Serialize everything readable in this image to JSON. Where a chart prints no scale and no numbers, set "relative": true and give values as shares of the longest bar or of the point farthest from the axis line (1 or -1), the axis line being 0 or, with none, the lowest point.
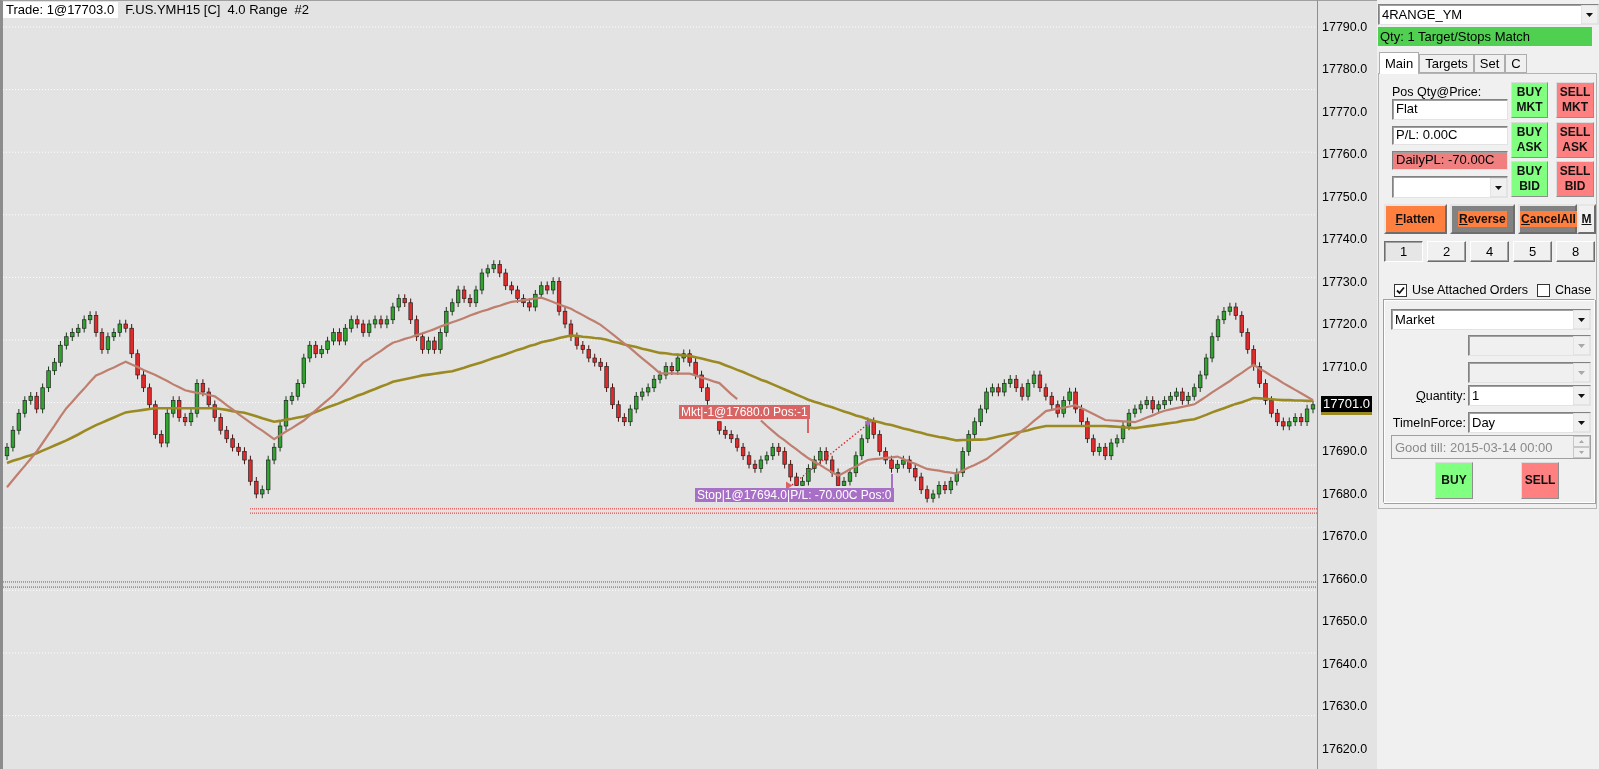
{
  "chart": {
    "header": {
      "trade": "Trade: 1@17703.0",
      "symbol": "F.US.YMH15 [C]",
      "bar_type": "4.0 Range",
      "chart_number": "#2"
    },
    "order_labels": [
      {
        "kind": "market",
        "text": "Mkt|-1@17680.0 Pos:-1",
        "color": "#d86464"
      },
      {
        "kind": "stop",
        "text": "Stop|1@17694.0|P/L: -70.00C Pos:0",
        "color": "#a86fc6"
      }
    ],
    "last_price": "17701.0",
    "chart_data": {
      "type": "candlestick",
      "ylim": [
        17615.29,
        17796.24
      ],
      "yticks": [
        {
          "value": 17790,
          "label": "17790.0"
        },
        {
          "value": 17780,
          "label": "17780.0"
        },
        {
          "value": 17770,
          "label": "17770.0"
        },
        {
          "value": 17760,
          "label": "17760.0"
        },
        {
          "value": 17750,
          "label": "17750.0"
        },
        {
          "value": 17740,
          "label": "17740.0"
        },
        {
          "value": 17730,
          "label": "17730.0"
        },
        {
          "value": 17720,
          "label": "17720.0"
        },
        {
          "value": 17710,
          "label": "17710.0"
        },
        {
          "value": 17690,
          "label": "17690.0"
        },
        {
          "value": 17680,
          "label": "17680.0"
        },
        {
          "value": 17670,
          "label": "17670.0"
        },
        {
          "value": 17660,
          "label": "17660.0"
        },
        {
          "value": 17650,
          "label": "17650.0"
        },
        {
          "value": 17640,
          "label": "17640.0"
        },
        {
          "value": 17630,
          "label": "17630.0"
        },
        {
          "value": 17620,
          "label": "17620.0"
        }
      ],
      "categories": [
        null,
        null,
        null,
        null,
        null,
        null,
        null,
        null,
        null,
        null,
        null,
        null,
        null,
        null,
        null,
        null,
        null,
        null,
        null,
        null,
        null,
        null,
        null,
        null,
        null,
        null,
        null,
        null,
        null,
        null,
        null,
        null,
        null,
        null,
        null,
        null,
        null,
        null,
        null,
        null,
        null,
        null,
        null,
        null,
        null,
        null,
        null,
        null,
        null,
        null,
        null,
        null,
        null,
        null,
        null,
        null,
        null,
        null,
        null,
        null,
        null,
        null,
        null,
        null,
        null,
        null,
        null,
        null,
        null,
        null,
        null,
        null,
        null,
        null,
        null,
        null,
        null,
        null,
        null,
        null,
        null,
        null,
        null,
        null,
        null,
        null,
        null,
        null,
        null,
        null,
        null,
        null,
        null,
        null,
        null,
        null,
        null,
        null,
        null,
        null,
        null,
        null,
        null,
        null,
        null,
        null,
        null,
        null,
        null,
        null,
        null,
        null,
        null,
        null,
        null,
        null,
        null,
        null,
        null,
        null,
        null,
        null,
        null,
        null,
        null,
        null,
        null,
        null,
        null,
        null,
        null,
        null,
        null,
        null,
        null,
        null,
        null,
        null,
        null,
        null,
        null,
        null,
        null,
        null,
        null,
        null,
        null,
        null,
        null,
        null,
        null,
        null,
        null,
        null,
        null,
        null,
        null,
        null,
        null,
        null,
        null,
        null,
        null,
        null,
        null,
        null,
        null,
        null,
        null,
        null,
        null,
        null,
        null,
        null,
        null,
        null,
        null,
        null,
        null,
        null,
        null,
        null,
        null,
        null,
        null,
        null,
        null,
        null,
        null,
        null,
        null,
        null,
        null,
        null,
        null,
        null,
        null,
        null,
        null,
        null,
        null,
        null,
        null,
        null,
        null,
        null,
        null,
        null,
        null,
        null,
        null,
        null,
        null,
        null,
        null,
        null,
        null,
        null,
        null,
        null,
        null
      ],
      "ohlc": [
        [
          17689,
          17692,
          17688,
          17691
        ],
        [
          17691,
          17696,
          17690,
          17695
        ],
        [
          17695,
          17700,
          17694,
          17699
        ],
        [
          17699,
          17703,
          17698,
          17702
        ],
        [
          17702,
          17704,
          17701,
          17703
        ],
        [
          17703,
          17704,
          17699,
          17700
        ],
        [
          17700,
          17706,
          17699,
          17705
        ],
        [
          17705,
          17710,
          17704,
          17709
        ],
        [
          17709,
          17712,
          17708,
          17711
        ],
        [
          17711,
          17716,
          17710,
          17715
        ],
        [
          17715,
          17718,
          17714,
          17717
        ],
        [
          17717,
          17719,
          17716,
          17718
        ],
        [
          17718,
          17720,
          17717,
          17719
        ],
        [
          17719,
          17722,
          17718,
          17721
        ],
        [
          17721,
          17723,
          17720,
          17722
        ],
        [
          17722,
          17723,
          17717,
          17718
        ],
        [
          17718,
          17719,
          17713,
          17714
        ],
        [
          17714,
          17718,
          17713,
          17717
        ],
        [
          17717,
          17719,
          17716,
          17718
        ],
        [
          17718,
          17721,
          17717,
          17720
        ],
        [
          17720,
          17721,
          17718,
          17719
        ],
        [
          17719,
          17720,
          17712,
          17713
        ],
        [
          17713,
          17714,
          17707,
          17708
        ],
        [
          17708,
          17709,
          17704,
          17705
        ],
        [
          17705,
          17706,
          17700,
          17701
        ],
        [
          17701,
          17702,
          17693,
          17694
        ],
        [
          17694,
          17695,
          17691,
          17692
        ],
        [
          17692,
          17700,
          17691,
          17699
        ],
        [
          17699,
          17703,
          17698,
          17702
        ],
        [
          17702,
          17703,
          17697,
          17698
        ],
        [
          17698,
          17699,
          17696,
          17697
        ],
        [
          17697,
          17700,
          17696,
          17699
        ],
        [
          17699,
          17707,
          17698,
          17706
        ],
        [
          17706,
          17707,
          17703,
          17704
        ],
        [
          17704,
          17705,
          17700,
          17701
        ],
        [
          17701,
          17702,
          17697,
          17698
        ],
        [
          17698,
          17699,
          17694,
          17695
        ],
        [
          17695,
          17696,
          17692,
          17693
        ],
        [
          17693,
          17694,
          17690,
          17691
        ],
        [
          17691,
          17692,
          17689,
          17690
        ],
        [
          17690,
          17691,
          17687,
          17688
        ],
        [
          17688,
          17689,
          17682,
          17683
        ],
        [
          17683,
          17684,
          17679,
          17680
        ],
        [
          17680,
          17682,
          17679,
          17681
        ],
        [
          17681,
          17689,
          17680,
          17688
        ],
        [
          17688,
          17692,
          17687,
          17691
        ],
        [
          17691,
          17697,
          17690,
          17696
        ],
        [
          17696,
          17703,
          17695,
          17702
        ],
        [
          17702,
          17704,
          17701,
          17703
        ],
        [
          17703,
          17707,
          17702,
          17706
        ],
        [
          17706,
          17713,
          17705,
          17712
        ],
        [
          17712,
          17716,
          17711,
          17715
        ],
        [
          17715,
          17716,
          17712,
          17713
        ],
        [
          17713,
          17715,
          17712,
          17714
        ],
        [
          17714,
          17717,
          17713,
          17716
        ],
        [
          17716,
          17719,
          17715,
          17718
        ],
        [
          17718,
          17719,
          17715,
          17716
        ],
        [
          17716,
          17720,
          17715,
          17719
        ],
        [
          17719,
          17722,
          17718,
          17721
        ],
        [
          17721,
          17722,
          17719,
          17720
        ],
        [
          17720,
          17721,
          17717,
          17718
        ],
        [
          17718,
          17721,
          17717,
          17720
        ],
        [
          17720,
          17722,
          17719,
          17721
        ],
        [
          17721,
          17722,
          17719,
          17720
        ],
        [
          17720,
          17722,
          17719,
          17721
        ],
        [
          17721,
          17725,
          17720,
          17724
        ],
        [
          17724,
          17727,
          17723,
          17726
        ],
        [
          17726,
          17727,
          17724,
          17725
        ],
        [
          17725,
          17726,
          17720,
          17721
        ],
        [
          17721,
          17722,
          17716,
          17717
        ],
        [
          17717,
          17718,
          17713,
          17714
        ],
        [
          17714,
          17717,
          17713,
          17716
        ],
        [
          17716,
          17717,
          17713,
          17714
        ],
        [
          17714,
          17719,
          17713,
          17718
        ],
        [
          17718,
          17724,
          17717,
          17723
        ],
        [
          17723,
          17726,
          17722,
          17725
        ],
        [
          17725,
          17729,
          17724,
          17728
        ],
        [
          17728,
          17729,
          17725,
          17726
        ],
        [
          17726,
          17727,
          17724,
          17725
        ],
        [
          17725,
          17729,
          17724,
          17728
        ],
        [
          17728,
          17733,
          17727,
          17732
        ],
        [
          17732,
          17734,
          17731,
          17733
        ],
        [
          17733,
          17735,
          17732,
          17734
        ],
        [
          17734,
          17735,
          17731,
          17732
        ],
        [
          17732,
          17733,
          17728,
          17729
        ],
        [
          17729,
          17730,
          17727,
          17728
        ],
        [
          17728,
          17729,
          17725,
          17726
        ],
        [
          17726,
          17727,
          17724,
          17725
        ],
        [
          17725,
          17726,
          17723,
          17724
        ],
        [
          17724,
          17728,
          17723,
          17727
        ],
        [
          17727,
          17730,
          17726,
          17729
        ],
        [
          17729,
          17730,
          17727,
          17728
        ],
        [
          17728,
          17731,
          17727,
          17730
        ],
        [
          17730,
          17731,
          17722,
          17723
        ],
        [
          17723,
          17724,
          17719,
          17720
        ],
        [
          17720,
          17721,
          17716,
          17717
        ],
        [
          17717,
          17718,
          17714,
          17715
        ],
        [
          17715,
          17716,
          17713,
          17714
        ],
        [
          17714,
          17715,
          17711,
          17712
        ],
        [
          17712,
          17713,
          17710,
          17711
        ],
        [
          17711,
          17712,
          17709,
          17710
        ],
        [
          17710,
          17711,
          17704,
          17705
        ],
        [
          17705,
          17706,
          17700,
          17701
        ],
        [
          17701,
          17702,
          17697,
          17698
        ],
        [
          17698,
          17699,
          17696,
          17697
        ],
        [
          17697,
          17701,
          17696,
          17700
        ],
        [
          17700,
          17704,
          17699,
          17703
        ],
        [
          17703,
          17705,
          17702,
          17704
        ],
        [
          17704,
          17706,
          17703,
          17705
        ],
        [
          17705,
          17708,
          17704,
          17707
        ],
        [
          17707,
          17709,
          17706,
          17708
        ],
        [
          17708,
          17711,
          17707,
          17710
        ],
        [
          17710,
          17711,
          17708,
          17709
        ],
        [
          17709,
          17713,
          17708,
          17712
        ],
        [
          17712,
          17714,
          17711,
          17713
        ],
        [
          17713,
          17714,
          17710,
          17711
        ],
        [
          17711,
          17712,
          17707,
          17708
        ],
        [
          17708,
          17709,
          17704,
          17705
        ],
        [
          17705,
          17706,
          17701,
          17702
        ],
        null,
        [
          17697,
          17697,
          17694,
          17695
        ],
        [
          17695,
          17696,
          17693,
          17694
        ],
        [
          17694,
          17695,
          17692,
          17693
        ],
        [
          17693,
          17694,
          17690,
          17691
        ],
        [
          17691,
          17692,
          17688,
          17689
        ],
        [
          17689,
          17690,
          17686,
          17687
        ],
        [
          17687,
          17688,
          17685,
          17686
        ],
        [
          17686,
          17689,
          17685,
          17688
        ],
        [
          17688,
          17690,
          17687,
          17689
        ],
        [
          17689,
          17692,
          17688,
          17691
        ],
        [
          17691,
          17692,
          17689,
          17690
        ],
        [
          17690,
          17691,
          17686,
          17687
        ],
        [
          17687,
          17688,
          17683,
          17684
        ],
        [
          17684,
          17685,
          17682,
          17682
        ],
        [
          17682,
          17684,
          17682,
          17683
        ],
        [
          17683,
          17687,
          17682,
          17686
        ],
        [
          17686,
          17689,
          17685,
          17688
        ],
        [
          17688,
          17691,
          17687,
          17690
        ],
        [
          17690,
          17691,
          17687,
          17688
        ],
        [
          17688,
          17689,
          17684,
          17685
        ],
        [
          17685,
          17686,
          17682,
          17682
        ],
        [
          17682,
          17684,
          17682,
          17683
        ],
        [
          17683,
          17686,
          17682,
          17685
        ],
        [
          17685,
          17690,
          17684,
          17689
        ],
        [
          17689,
          17694,
          17688,
          17693
        ],
        [
          17693,
          17698,
          17692,
          17697
        ],
        [
          17697,
          17698,
          17693,
          17694
        ],
        [
          17694,
          17695,
          17689,
          17690
        ],
        [
          17690,
          17691,
          17687,
          17688
        ],
        [
          17688,
          17689,
          17685,
          17686
        ],
        [
          17686,
          17688,
          17685,
          17687
        ],
        [
          17687,
          17689,
          17686,
          17688
        ],
        [
          17688,
          17689,
          17685,
          17686
        ],
        [
          17686,
          17687,
          17683,
          17684
        ],
        [
          17684,
          17685,
          17680,
          17681
        ],
        [
          17681,
          17682,
          17678,
          17679
        ],
        [
          17679,
          17681,
          17678,
          17680
        ],
        [
          17680,
          17683,
          17679,
          17682
        ],
        [
          17682,
          17683,
          17680,
          17681
        ],
        [
          17681,
          17684,
          17680,
          17683
        ],
        [
          17683,
          17686,
          17682,
          17685
        ],
        [
          17685,
          17691,
          17684,
          17690
        ],
        [
          17690,
          17695,
          17689,
          17694
        ],
        [
          17694,
          17698,
          17693,
          17697
        ],
        [
          17697,
          17701,
          17696,
          17700
        ],
        [
          17700,
          17705,
          17699,
          17704
        ],
        [
          17704,
          17706,
          17703,
          17705
        ],
        [
          17705,
          17706,
          17703,
          17704
        ],
        [
          17704,
          17707,
          17703,
          17706
        ],
        [
          17706,
          17708,
          17705,
          17707
        ],
        [
          17707,
          17708,
          17704,
          17705
        ],
        [
          17705,
          17706,
          17702,
          17703
        ],
        [
          17703,
          17707,
          17702,
          17706
        ],
        [
          17706,
          17709,
          17705,
          17708
        ],
        [
          17708,
          17709,
          17704,
          17705
        ],
        [
          17705,
          17706,
          17702,
          17703
        ],
        [
          17703,
          17704,
          17700,
          17701
        ],
        [
          17701,
          17702,
          17698,
          17699
        ],
        [
          17699,
          17703,
          17698,
          17702
        ],
        [
          17702,
          17705,
          17701,
          17704
        ],
        [
          17704,
          17705,
          17699,
          17700
        ],
        [
          17700,
          17701,
          17696,
          17697
        ],
        [
          17697,
          17698,
          17692,
          17693
        ],
        [
          17693,
          17694,
          17689,
          17690
        ],
        [
          17690,
          17692,
          17689,
          17691
        ],
        [
          17691,
          17692,
          17688,
          17689
        ],
        [
          17689,
          17693,
          17688,
          17692
        ],
        [
          17692,
          17694,
          17691,
          17693
        ],
        [
          17693,
          17697,
          17692,
          17696
        ],
        [
          17696,
          17700,
          17695,
          17699
        ],
        [
          17699,
          17701,
          17698,
          17700
        ],
        [
          17700,
          17702,
          17699,
          17701
        ],
        [
          17701,
          17703,
          17700,
          17702
        ],
        [
          17702,
          17703,
          17699,
          17700
        ],
        [
          17700,
          17702,
          17699,
          17701
        ],
        [
          17701,
          17703,
          17700,
          17702
        ],
        [
          17702,
          17704,
          17701,
          17703
        ],
        [
          17703,
          17705,
          17702,
          17704
        ],
        [
          17704,
          17705,
          17701,
          17702
        ],
        [
          17702,
          17704,
          17701,
          17703
        ],
        [
          17703,
          17706,
          17702,
          17705
        ],
        [
          17705,
          17709,
          17704,
          17708
        ],
        [
          17708,
          17713,
          17707,
          17712
        ],
        [
          17712,
          17718,
          17711,
          17717
        ],
        [
          17717,
          17722,
          17716,
          17721
        ],
        [
          17721,
          17724,
          17720,
          17723
        ],
        [
          17723,
          17725,
          17722,
          17724
        ],
        [
          17724,
          17725,
          17721,
          17722
        ],
        [
          17722,
          17723,
          17717,
          17718
        ],
        [
          17718,
          17719,
          17713,
          17714
        ],
        [
          17714,
          17715,
          17709,
          17710
        ],
        [
          17710,
          17711,
          17705,
          17706
        ],
        [
          17706,
          17707,
          17701,
          17702
        ],
        [
          17702,
          17703,
          17698,
          17699
        ],
        [
          17699,
          17700,
          17696,
          17697
        ],
        [
          17697,
          17698,
          17695,
          17696
        ],
        [
          17696,
          17698,
          17695,
          17697
        ],
        [
          17697,
          17699,
          17696,
          17698
        ],
        [
          17698,
          17699,
          17696,
          17697
        ],
        [
          17697,
          17701,
          17696,
          17700
        ],
        [
          17700,
          17702,
          17699,
          17701
        ]
      ],
      "ref_lines": [
        {
          "axis": "y",
          "value": 17676.5
        },
        {
          "axis": "y",
          "value": 17675.5
        },
        {
          "axis": "y",
          "value": 17659.3
        },
        {
          "axis": "y",
          "value": 17658.1
        }
      ]
    },
    "overlay": {
      "chart_data": {
        "type": "line",
        "relative": true,
        "ylim": [
          17615.29,
          17796.24
        ],
        "series": [
          {
            "color": "#9b8a22",
            "values": [
              17687.3,
              17687.8,
              17688.2,
              17688.7,
              17689.1,
              17689.6,
              17690.2,
              17690.8,
              17691.4,
              17692.0,
              17692.6,
              17693.3,
              17694.0,
              17694.8,
              17695.5,
              17696.2,
              17696.8,
              17697.4,
              17698.0,
              17698.6,
              17699.2,
              17699.4,
              17699.6,
              17699.8,
              17700.0,
              17700.2,
              17700.2,
              17700.2,
              17700.2,
              17700.2,
              17700.2,
              17700.2,
              17700.2,
              17700.2,
              17700.2,
              17700.2,
              17700.0,
              17699.8,
              17699.5,
              17699.3,
              17699.1,
              17698.7,
              17698.3,
              17697.8,
              17697.4,
              17697.0,
              17697.2,
              17697.5,
              17697.7,
              17698.0,
              17698.2,
              17698.7,
              17699.3,
              17699.8,
              17700.4,
              17700.9,
              17701.4,
              17702.0,
              17702.5,
              17703.1,
              17703.6,
              17704.2,
              17704.7,
              17705.3,
              17705.8,
              17706.4,
              17706.7,
              17707.0,
              17707.3,
              17707.6,
              17707.9,
              17708.1,
              17708.3,
              17708.5,
              17708.7,
              17708.9,
              17709.3,
              17709.7,
              17710.2,
              17710.6,
              17711.0,
              17711.5,
              17712.0,
              17712.4,
              17712.9,
              17713.4,
              17713.9,
              17714.3,
              17714.8,
              17715.2,
              17715.7,
              17716.0,
              17716.3,
              17716.7,
              17717.0,
              17717.3,
              17717.2,
              17717.0,
              17716.9,
              17716.7,
              17716.6,
              17716.3,
              17715.9,
              17715.6,
              17715.2,
              17714.9,
              17714.6,
              17714.2,
              17713.9,
              17713.5,
              17713.2,
              17713.1,
              17712.9,
              17712.8,
              17712.6,
              17712.5,
              17712.2,
              17711.9,
              17711.5,
              17711.2,
              17710.9,
              17710.3,
              17709.8,
              17709.2,
              17708.7,
              17708.1,
              17707.5,
              17706.9,
              17706.4,
              17705.8,
              17705.2,
              17704.6,
              17704.0,
              17703.4,
              17702.8,
              17702.2,
              17701.7,
              17701.3,
              17700.8,
              17700.4,
              17699.9,
              17699.4,
              17699.0,
              17698.5,
              17698.1,
              17697.6,
              17697.2,
              17696.9,
              17696.5,
              17696.2,
              17695.8,
              17695.4,
              17695.1,
              17694.7,
              17694.4,
              17694.0,
              17693.7,
              17693.4,
              17693.2,
              17692.9,
              17692.6,
              17692.7,
              17692.7,
              17692.8,
              17692.8,
              17692.9,
              17693.2,
              17693.5,
              17693.8,
              17694.1,
              17694.4,
              17694.7,
              17695.0,
              17695.4,
              17695.7,
              17696.0,
              17696.0,
              17696.0,
              17696.0,
              17696.0,
              17696.0,
              17696.0,
              17696.0,
              17696.0,
              17696.0,
              17696.0,
              17695.9,
              17695.8,
              17695.7,
              17695.6,
              17695.5,
              17695.7,
              17695.9,
              17696.1,
              17696.3,
              17696.5,
              17696.7,
              17696.9,
              17697.2,
              17697.4,
              17697.6,
              17698.1,
              17698.6,
              17699.2,
              17699.7,
              17700.2,
              17700.7,
              17701.2,
              17701.6,
              17702.1,
              17702.6,
              17702.5,
              17702.4,
              17702.3,
              17702.2,
              17702.1,
              17702.1,
              17702.0,
              17702.0,
              17701.9,
              17701.9
            ]
          },
          {
            "color": "#bf7f6f",
            "values": [
              17681.6,
              17683.3,
              17685.0,
              17686.6,
              17688.3,
              17690.0,
              17692.0,
              17694.1,
              17696.1,
              17698.2,
              17700.2,
              17701.7,
              17703.3,
              17704.8,
              17706.4,
              17707.9,
              17708.5,
              17709.2,
              17709.8,
              17710.5,
              17711.1,
              17710.5,
              17709.9,
              17709.2,
              17708.6,
              17708.0,
              17707.3,
              17706.6,
              17705.8,
              17705.1,
              17704.4,
              17704.1,
              17703.8,
              17703.6,
              17703.3,
              17703.0,
              17702.0,
              17700.9,
              17699.9,
              17698.8,
              17697.8,
              17696.8,
              17695.8,
              17694.9,
              17693.9,
              17692.9,
              17693.8,
              17694.7,
              17695.5,
              17696.4,
              17697.3,
              17698.5,
              17699.7,
              17700.9,
              17702.1,
              17703.3,
              17704.8,
              17706.3,
              17707.9,
              17709.4,
              17710.9,
              17711.8,
              17712.8,
              17713.7,
              17714.7,
              17715.6,
              17716.0,
              17716.5,
              17716.9,
              17717.4,
              17717.8,
              17718.3,
              17718.8,
              17719.4,
              17719.9,
              17720.4,
              17720.9,
              17721.4,
              17722.0,
              17722.5,
              17723.0,
              17723.4,
              17723.9,
              17724.3,
              17724.8,
              17725.2,
              17725.4,
              17725.6,
              17725.8,
              17726.0,
              17726.2,
              17725.7,
              17725.2,
              17724.6,
              17724.1,
              17723.6,
              17722.8,
              17722.1,
              17721.3,
              17720.6,
              17719.8,
              17718.7,
              17717.6,
              17716.5,
              17715.4,
              17714.3,
              17713.1,
              17711.9,
              17710.8,
              17709.6,
              17708.4,
              17708.4,
              17708.4,
              17708.3,
              17708.3,
              17708.3,
              17707.9,
              17707.4,
              17707.0,
              17706.5,
              17706.1,
              17704.8,
              17703.5,
              17702.3,
              null,
              null,
              null,
              17697.3,
              17696.0,
              17694.8,
              17693.6,
              17692.6,
              17691.5,
              17690.5,
              17689.4,
              17688.4,
              17687.6,
              17686.8,
              17685.9,
              17685.1,
              17684.3,
              17685.0,
              17685.8,
              17686.5,
              17687.3,
              17688.0,
              17688.2,
              17688.3,
              17688.5,
              17688.6,
              17688.8,
              17688.2,
              17687.6,
              17687.1,
              17686.5,
              17685.9,
              17685.7,
              17685.5,
              17685.2,
              17685.0,
              17684.8,
              17685.5,
              17686.2,
              17686.8,
              17687.5,
              17688.2,
              17689.3,
              17690.4,
              17691.5,
              17692.6,
              17693.7,
              17694.9,
              17696.0,
              17697.2,
              17698.3,
              17699.5,
              17699.8,
              17700.1,
              17700.3,
              17700.6,
              17700.9,
              17700.2,
              17699.5,
              17698.8,
              17698.1,
              17697.4,
              17697.3,
              17697.2,
              17697.1,
              17697.0,
              17696.9,
              17697.4,
              17698.0,
              17698.5,
              17699.1,
              17699.6,
              17699.9,
              17700.2,
              17700.5,
              17700.8,
              17701.1,
              17702.0,
              17702.9,
              17703.9,
              17704.8,
              17705.7,
              17706.6,
              17707.6,
              17708.5,
              17709.5,
              17710.4,
              17709.5,
              17708.7,
              17707.8,
              17707.0,
              17706.1,
              17705.3,
              17704.5,
              17703.7,
              17702.9,
              17702.1
            ]
          }
        ]
      }
    }
  },
  "order_panel": {
    "strategy": "4RANGE_YM",
    "status": "Qty: 1 Target/Stops Match",
    "tabs": [
      {
        "label": "Main",
        "selected": true
      },
      {
        "label": "Targets",
        "selected": false
      },
      {
        "label": "Set",
        "selected": false
      },
      {
        "label": "C",
        "selected": false
      }
    ],
    "position": {
      "caption": "Pos Qty@Price:",
      "value": "Flat",
      "pl": "P/L: 0.00C",
      "daily_pl": {
        "text": "DailyPL: -70.00C",
        "loss": true
      }
    },
    "quick_orders": [
      {
        "kind": "buy",
        "label": "BUY MKT"
      },
      {
        "kind": "sell",
        "label": "SELL MKT"
      },
      {
        "kind": "buy",
        "label": "BUY ASK"
      },
      {
        "kind": "sell",
        "label": "SELL ASK"
      },
      {
        "kind": "buy",
        "label": "BUY BID"
      },
      {
        "kind": "sell",
        "label": "SELL BID"
      }
    ],
    "actions": [
      {
        "kind": "flatten",
        "label": "Flatten"
      },
      {
        "kind": "reverse",
        "label": "Reverse"
      },
      {
        "kind": "cancel",
        "label": "CancelAll"
      },
      {
        "kind": "plain",
        "label": "M"
      }
    ],
    "quantity_presets": [
      {
        "label": "1",
        "selected": true
      },
      {
        "label": "2",
        "selected": false
      },
      {
        "label": "4",
        "selected": false
      },
      {
        "label": "5",
        "selected": false
      },
      {
        "label": "8",
        "selected": false
      }
    ],
    "options": [
      {
        "label": "Use Attached Orders",
        "checked": true
      },
      {
        "label": "Chase",
        "checked": false
      }
    ],
    "order_form": {
      "order_type": "Market",
      "price_selects": [
        {
          "disabled": true
        },
        {
          "disabled": true
        }
      ],
      "quantity": {
        "label": "Quantity:",
        "value": "1"
      },
      "time_in_force": {
        "label": "TimeInForce:",
        "value": "Day"
      },
      "good_till": {
        "text": "Good till: 2015-03-14 00:00",
        "disabled": true
      },
      "submit": [
        {
          "kind": "buy",
          "label": "BUY"
        },
        {
          "kind": "sell",
          "label": "SELL"
        }
      ]
    }
  }
}
